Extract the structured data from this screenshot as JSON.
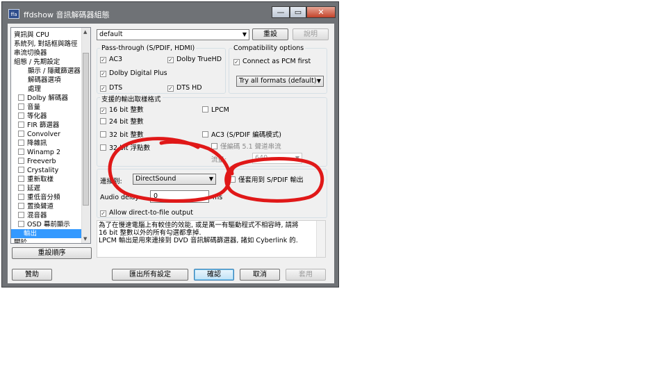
{
  "window": {
    "title": "ffdshow 音訊解碼器組態",
    "icon_text": "ffa",
    "controls": {
      "minimize": "—",
      "maximize": "▭",
      "close": "✕"
    }
  },
  "sidebar": {
    "items": [
      {
        "label": "資訊與 CPU",
        "checkbox": false
      },
      {
        "label": "系統列, 對話框與路徑",
        "checkbox": false
      },
      {
        "label": "串流切換器",
        "checkbox": false
      },
      {
        "label": "組態 / 先期設定",
        "checkbox": false
      },
      {
        "label": "顯示 / 隱藏篩選器",
        "checkbox": false
      },
      {
        "label": "解碼器選項",
        "checkbox": false
      },
      {
        "label": "處理",
        "checkbox": false
      },
      {
        "label": "Dolby 解碼器",
        "checkbox": true
      },
      {
        "label": "音量",
        "checkbox": true
      },
      {
        "label": "等化器",
        "checkbox": true
      },
      {
        "label": "FIR 篩選器",
        "checkbox": true
      },
      {
        "label": "Convolver",
        "checkbox": true
      },
      {
        "label": "降雜訊",
        "checkbox": true
      },
      {
        "label": "Winamp 2",
        "checkbox": true
      },
      {
        "label": "Freeverb",
        "checkbox": true
      },
      {
        "label": "Crystality",
        "checkbox": true
      },
      {
        "label": "重新取樣",
        "checkbox": true
      },
      {
        "label": "延遲",
        "checkbox": true
      },
      {
        "label": "重低音分頻",
        "checkbox": true
      },
      {
        "label": "置換聲道",
        "checkbox": true
      },
      {
        "label": "混音器",
        "checkbox": true
      },
      {
        "label": "OSD 幕前顯示",
        "checkbox": true
      },
      {
        "label": "輸出",
        "checkbox": false,
        "selected": true
      },
      {
        "label": "關於",
        "checkbox": false
      }
    ],
    "reset_order_label": "重設順序"
  },
  "top": {
    "preset_value": "default",
    "reset_label": "重設",
    "help_label": "說明"
  },
  "passthrough": {
    "title": "Pass-through (S/PDIF, HDMI)",
    "ac3": "AC3",
    "truehd": "Dolby TrueHD",
    "ddplus": "Dolby Digital Plus",
    "dts": "DTS",
    "dtshd": "DTS HD"
  },
  "compat": {
    "title": "Compatibility options",
    "connect_pcm": "Connect as PCM first",
    "formats_value": "Try all formats (default)"
  },
  "formats": {
    "title": "支援的輸出取樣格式",
    "int16": "16 bit 整數",
    "int24": "24 bit 整數",
    "int32": "32 bit 整數",
    "float32": "32 bit 浮點數",
    "lpcm": "LPCM",
    "ac3_spdif": "AC3 (S/PDIF 編碼模式)",
    "only_51": "僅編碼 5.1 聲道串流",
    "bitrate_label": "流量:",
    "bitrate_value": "640"
  },
  "output": {
    "connect_label": "連接到:",
    "connect_value": "DirectSound",
    "spdif_only": "僅套用到 S/PDIF 輸出",
    "delay_label": "Audio delay",
    "delay_value": "0",
    "delay_unit": "ms",
    "direct_to_file": "Allow direct-to-file output"
  },
  "info": {
    "lines": [
      "為了在慢速電腦上有較佳的效能, 或是萬一有驅動程式不相容時, 請將",
      "16 bit 整數以外的所有勾選都拿掉.",
      "LPCM 輸出是用來連接到 DVD 音訊解碼篩選器, 諸如 Cyberlink 的."
    ]
  },
  "footer": {
    "help_label": "贊助",
    "export_label": "匯出所有設定",
    "ok_label": "確認",
    "cancel_label": "取消",
    "apply_label": "套用"
  },
  "colors": {
    "selection": "#3399ff",
    "annotation": "#e01818",
    "window_frame": "#6f7276"
  }
}
